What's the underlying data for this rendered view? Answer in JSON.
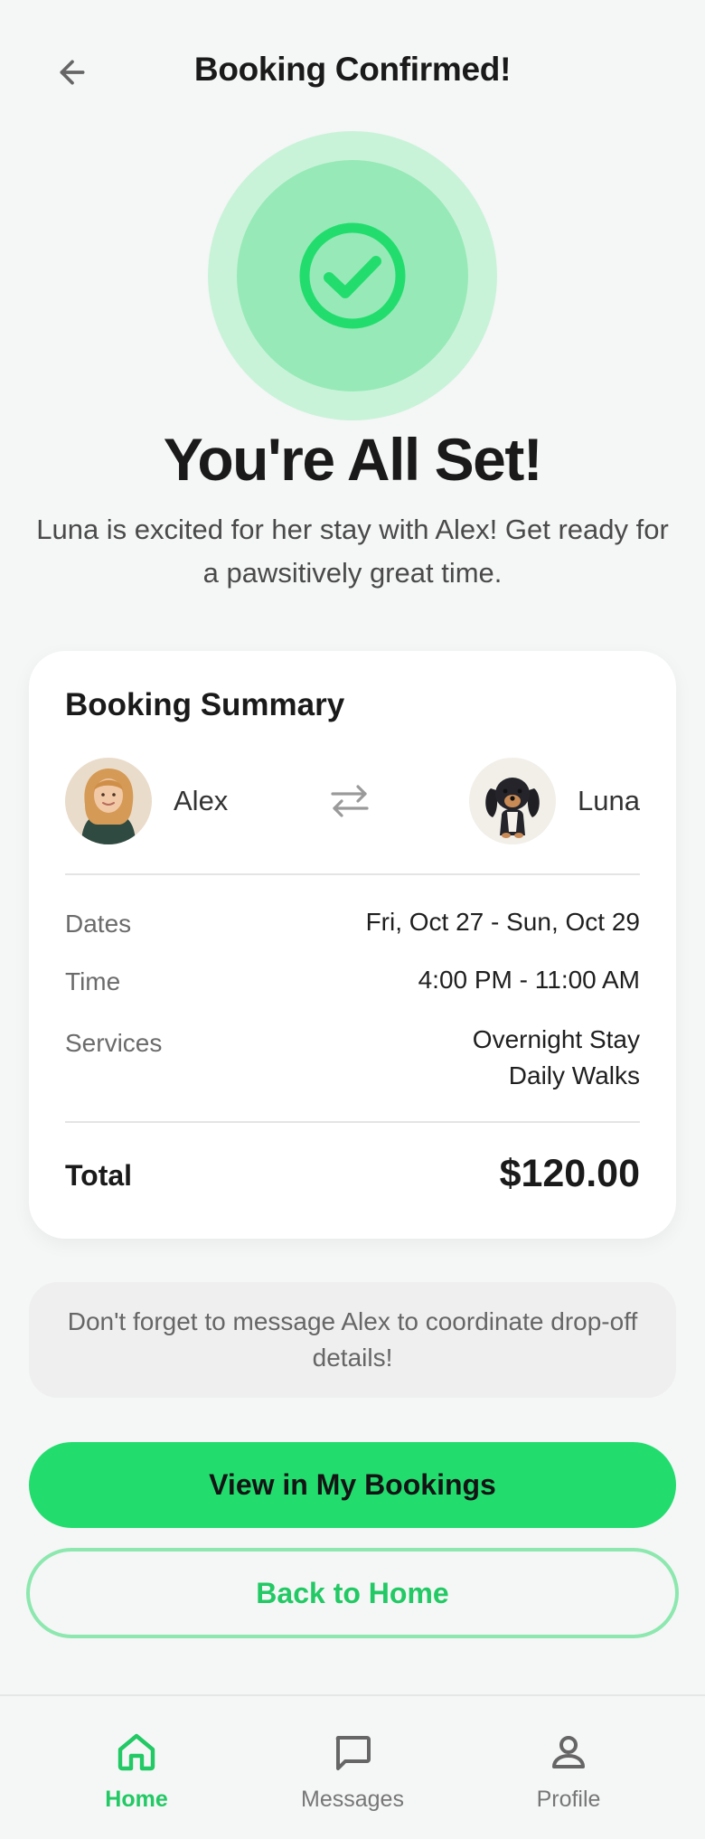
{
  "header": {
    "title": "Booking Confirmed!",
    "back_icon": "arrow-left-icon"
  },
  "hero": {
    "icon": "check-circle-icon",
    "title": "You're All Set!",
    "subtitle": "Luna is excited for her stay with Alex! Get ready for a pawsitively great time."
  },
  "summary": {
    "title": "Booking Summary",
    "sitter_name": "Alex",
    "pet_name": "Luna",
    "swap_icon": "swap-arrows-icon",
    "rows": [
      {
        "label": "Dates",
        "value": "Fri, Oct 27 - Sun, Oct 29"
      },
      {
        "label": "Time",
        "value": "4:00 PM - 11:00 AM"
      },
      {
        "label": "Services",
        "values": [
          "Overnight Stay",
          "Daily Walks"
        ]
      }
    ],
    "total_label": "Total",
    "total_value": "$120.00"
  },
  "note": "Don't forget to message Alex to coordinate drop-off details!",
  "buttons": {
    "primary": "View in My Bookings",
    "secondary": "Back to Home"
  },
  "nav": [
    {
      "label": "Home",
      "icon": "home-icon",
      "active": true
    },
    {
      "label": "Messages",
      "icon": "message-icon",
      "active": false
    },
    {
      "label": "Profile",
      "icon": "user-icon",
      "active": false
    }
  ],
  "colors": {
    "accent": "#22dd6e",
    "accent_text": "#22c964",
    "background": "#f5f6f6"
  }
}
